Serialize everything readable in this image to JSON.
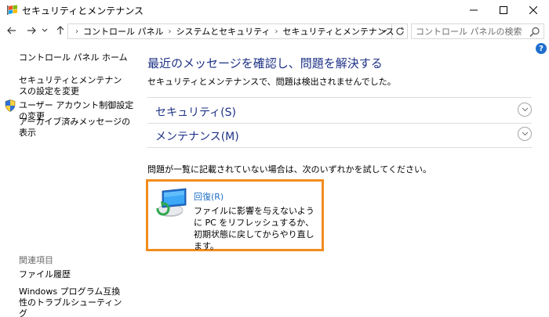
{
  "window": {
    "title": "セキュリティとメンテナンス"
  },
  "address": {
    "crumbs": [
      "コントロール パネル",
      "システムとセキュリティ",
      "セキュリティとメンテナンス"
    ],
    "search_placeholder": "コントロール パネルの検索"
  },
  "left_pane": {
    "home": "コントロール パネル ホーム",
    "settings_change": "セキュリティとメンテナンスの設定を変更",
    "uac_change": "ユーザー アカウント制御設定の変更",
    "archived_messages": "アーカイブ済みメッセージの表示",
    "related_heading": "関連項目",
    "file_history": "ファイル履歴",
    "compat_troubleshoot": "Windows プログラム互換性のトラブルシューティング"
  },
  "main": {
    "title": "最近のメッセージを確認し、問題を解決する",
    "subtitle": "セキュリティとメンテナンスで、問題は検出されませんでした。",
    "sections": [
      {
        "label": "セキュリティ(S)"
      },
      {
        "label": "メンテナンス(M)"
      }
    ],
    "hint": "問題が一覧に記載されていない場合は、次のいずれかを試してください。",
    "recovery": {
      "title": "回復(R)",
      "description": "ファイルに影響を与えないように PC をリフレッシュするか、初期状態に戻してからやり直します。"
    }
  },
  "colors": {
    "link_blue": "#1e3287",
    "recovery_link": "#1e6fc7",
    "highlight_orange": "#f28c1e",
    "help_blue": "#1f6fce"
  },
  "icons": {
    "app": "control-panel-flag-icon",
    "uac": "uac-shield-icon",
    "recovery": "recovery-pc-icon"
  }
}
